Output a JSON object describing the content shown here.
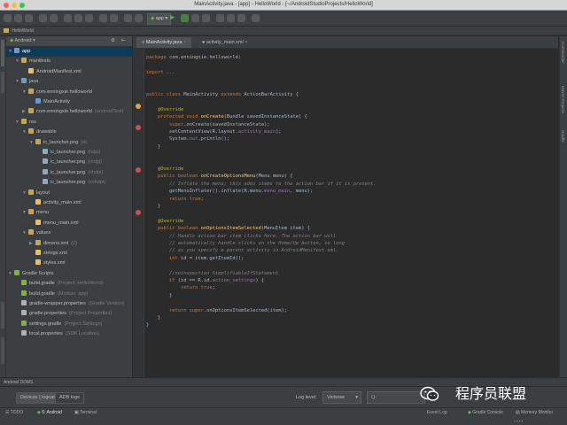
{
  "window": {
    "title": "MainActivity.java - [app] - HelloWorld - [~/AndroidStudioProjects/HelloWorld]",
    "nav_label": "HelloWorld",
    "run_config": "app"
  },
  "breadcrumb": "HelloWorld",
  "project_panel": {
    "view_mode": "Android",
    "tree": [
      {
        "label": "app",
        "indent": 0,
        "icon": "module-icon",
        "color": "#6d9cbe",
        "expanded": true,
        "selected": true
      },
      {
        "label": "manifests",
        "indent": 1,
        "icon": "folder-icon",
        "color": "#c5a55a",
        "expanded": true
      },
      {
        "label": "AndroidManifest.xml",
        "indent": 2,
        "icon": "xml-file-icon",
        "color": "#e8bf6a"
      },
      {
        "label": "java",
        "indent": 1,
        "icon": "folder-icon",
        "color": "#6d9cbe",
        "expanded": true
      },
      {
        "label": "com.enningxie.helloworld",
        "indent": 2,
        "icon": "package-icon",
        "color": "#c5a55a",
        "expanded": true
      },
      {
        "label": "MainActivity",
        "indent": 3,
        "icon": "class-icon",
        "color": "#5c9fd6"
      },
      {
        "label": "com.enningxie.helloworld",
        "suffix": "(androidTest)",
        "indent": 2,
        "icon": "package-icon",
        "color": "#c5a55a",
        "expanded": false
      },
      {
        "label": "res",
        "indent": 1,
        "icon": "folder-icon",
        "color": "#c5a55a",
        "expanded": true
      },
      {
        "label": "drawable",
        "indent": 2,
        "icon": "folder-icon",
        "color": "#c5a55a",
        "expanded": true
      },
      {
        "label": "ic_launcher.png",
        "suffix": "(4)",
        "indent": 3,
        "icon": "folder-icon",
        "color": "#c5a55a",
        "expanded": true
      },
      {
        "label": "ic_launcher.png",
        "suffix": "(hdpi)",
        "indent": 4,
        "icon": "image-file-icon",
        "color": "#8fa8c0"
      },
      {
        "label": "ic_launcher.png",
        "suffix": "(mdpi)",
        "indent": 4,
        "icon": "image-file-icon",
        "color": "#8fa8c0"
      },
      {
        "label": "ic_launcher.png",
        "suffix": "(xhdpi)",
        "indent": 4,
        "icon": "image-file-icon",
        "color": "#8fa8c0"
      },
      {
        "label": "ic_launcher.png",
        "suffix": "(xxhdpi)",
        "indent": 4,
        "icon": "image-file-icon",
        "color": "#8fa8c0"
      },
      {
        "label": "layout",
        "indent": 2,
        "icon": "folder-icon",
        "color": "#c5a55a",
        "expanded": true
      },
      {
        "label": "activity_main.xml",
        "indent": 3,
        "icon": "xml-file-icon",
        "color": "#e8bf6a"
      },
      {
        "label": "menu",
        "indent": 2,
        "icon": "folder-icon",
        "color": "#c5a55a",
        "expanded": true
      },
      {
        "label": "menu_main.xml",
        "indent": 3,
        "icon": "xml-file-icon",
        "color": "#e8bf6a"
      },
      {
        "label": "values",
        "indent": 2,
        "icon": "folder-icon",
        "color": "#c5a55a",
        "expanded": true
      },
      {
        "label": "dimens.xml",
        "suffix": "(2)",
        "indent": 3,
        "icon": "folder-icon",
        "color": "#c5a55a",
        "expanded": false
      },
      {
        "label": "strings.xml",
        "indent": 3,
        "icon": "xml-file-icon",
        "color": "#e8bf6a"
      },
      {
        "label": "styles.xml",
        "indent": 3,
        "icon": "xml-file-icon",
        "color": "#e8bf6a"
      },
      {
        "label": "Gradle Scripts",
        "indent": 0,
        "icon": "gradle-icon",
        "color": "#7fb04a",
        "expanded": true
      },
      {
        "label": "build.gradle",
        "suffix": "(Project: HelloWorld)",
        "indent": 1,
        "icon": "gradle-file-icon",
        "color": "#7fb04a"
      },
      {
        "label": "build.gradle",
        "suffix": "(Module: app)",
        "indent": 1,
        "icon": "gradle-file-icon",
        "color": "#7fb04a"
      },
      {
        "label": "gradle-wrapper.properties",
        "suffix": "(Gradle Version)",
        "indent": 1,
        "icon": "properties-file-icon",
        "color": "#b0b0b0"
      },
      {
        "label": "gradle.properties",
        "suffix": "(Project Properties)",
        "indent": 1,
        "icon": "properties-file-icon",
        "color": "#b0b0b0"
      },
      {
        "label": "settings.gradle",
        "suffix": "(Project Settings)",
        "indent": 1,
        "icon": "gradle-file-icon",
        "color": "#7fb04a"
      },
      {
        "label": "local.properties",
        "suffix": "(SDK Location)",
        "indent": 1,
        "icon": "properties-file-icon",
        "color": "#b0b0b0"
      }
    ]
  },
  "editor": {
    "tabs": [
      {
        "label": "MainActivity.java",
        "active": true
      },
      {
        "label": "activity_main.xml",
        "active": false
      }
    ],
    "code_lines": [
      [
        {
          "t": "package ",
          "c": "kw"
        },
        {
          "t": "com.enningxie.helloworld;",
          "c": ""
        }
      ],
      [],
      [
        {
          "t": "import ",
          "c": "kw"
        },
        {
          "t": "...",
          "c": "cm"
        }
      ],
      [],
      [],
      [
        {
          "t": "public class ",
          "c": "kw"
        },
        {
          "t": "MainActivity ",
          "c": ""
        },
        {
          "t": "extends ",
          "c": "kw"
        },
        {
          "t": "ActionBarActivity {",
          "c": ""
        }
      ],
      [],
      [
        {
          "t": "    @Override",
          "c": "an"
        }
      ],
      [
        {
          "t": "    protected void ",
          "c": "kw"
        },
        {
          "t": "onCreate",
          "c": "fn"
        },
        {
          "t": "(Bundle savedInstanceState) {",
          "c": ""
        }
      ],
      [
        {
          "t": "        super",
          "c": "kw"
        },
        {
          "t": ".onCreate(savedInstanceState);",
          "c": ""
        }
      ],
      [
        {
          "t": "        setContentView(R.layout.",
          "c": ""
        },
        {
          "t": "activity_main",
          "c": "fd"
        },
        {
          "t": ");",
          "c": ""
        }
      ],
      [
        {
          "t": "        System.",
          "c": ""
        },
        {
          "t": "out",
          "c": "fd"
        },
        {
          "t": ".println();",
          "c": ""
        }
      ],
      [
        {
          "t": "    }",
          "c": ""
        }
      ],
      [],
      [],
      [
        {
          "t": "    @Override",
          "c": "an"
        }
      ],
      [
        {
          "t": "    public boolean ",
          "c": "kw"
        },
        {
          "t": "onCreateOptionsMenu",
          "c": "fn"
        },
        {
          "t": "(Menu menu) {",
          "c": ""
        }
      ],
      [
        {
          "t": "        // Inflate the menu; this adds items to the action bar if it is present.",
          "c": "cm"
        }
      ],
      [
        {
          "t": "        getMenuInflater().inflate(R.menu.",
          "c": ""
        },
        {
          "t": "menu_main",
          "c": "fd"
        },
        {
          "t": ", menu);",
          "c": ""
        }
      ],
      [
        {
          "t": "        return true",
          "c": "kw"
        },
        {
          "t": ";",
          "c": ""
        }
      ],
      [
        {
          "t": "    }",
          "c": ""
        }
      ],
      [],
      [
        {
          "t": "    @Override",
          "c": "an"
        }
      ],
      [
        {
          "t": "    public boolean ",
          "c": "kw"
        },
        {
          "t": "onOptionsItemSelected",
          "c": "fn"
        },
        {
          "t": "(MenuItem item) {",
          "c": ""
        }
      ],
      [
        {
          "t": "        // Handle action bar item clicks here. The action bar will",
          "c": "cm"
        }
      ],
      [
        {
          "t": "        // automatically handle clicks on the Home/Up button, so long",
          "c": "cm"
        }
      ],
      [
        {
          "t": "        // as you specify a parent activity in AndroidManifest.xml.",
          "c": "cm"
        }
      ],
      [
        {
          "t": "        int ",
          "c": "kw"
        },
        {
          "t": "id = item.getItemId();",
          "c": ""
        }
      ],
      [],
      [
        {
          "t": "        //noinspection SimplifiableIfStatement",
          "c": "cm"
        }
      ],
      [
        {
          "t": "        if ",
          "c": "kw"
        },
        {
          "t": "(id == R.id.",
          "c": ""
        },
        {
          "t": "action_settings",
          "c": "fd"
        },
        {
          "t": ") {",
          "c": ""
        }
      ],
      [
        {
          "t": "            return true",
          "c": "kw"
        },
        {
          "t": ";",
          "c": ""
        }
      ],
      [
        {
          "t": "        }",
          "c": ""
        }
      ],
      [],
      [
        {
          "t": "        return super",
          "c": "kw"
        },
        {
          "t": ".onOptionsItemSelected(item);",
          "c": ""
        }
      ],
      [
        {
          "t": "    }",
          "c": ""
        }
      ],
      [
        {
          "t": "}",
          "c": ""
        }
      ]
    ]
  },
  "bottom_panel": {
    "title": "Android DDMS",
    "tab_devices": "Devices | logcat",
    "tab_adb": "ADB logs",
    "log_level_label": "Log level:",
    "log_level_value": "Verbose",
    "search_placeholder": "Q-"
  },
  "status_bar": {
    "todo": "TODO",
    "android": "6: Android",
    "terminal": "Terminal",
    "event_log": "Event Log",
    "gradle_console": "Gradle Console",
    "memory_monitor": "Memory Monitor"
  },
  "right_strip_labels": [
    "Commander",
    "Maven Projects",
    "Gradle"
  ],
  "watermark": {
    "text": "程序员联盟"
  },
  "colors": {
    "background": "#2b2b2b",
    "panel": "#3c3f41",
    "keyword": "#cc7832",
    "annotation": "#bbb529",
    "comment": "#808080",
    "method": "#ffc66d",
    "field": "#9876aa",
    "selection": "#0d3a58"
  }
}
